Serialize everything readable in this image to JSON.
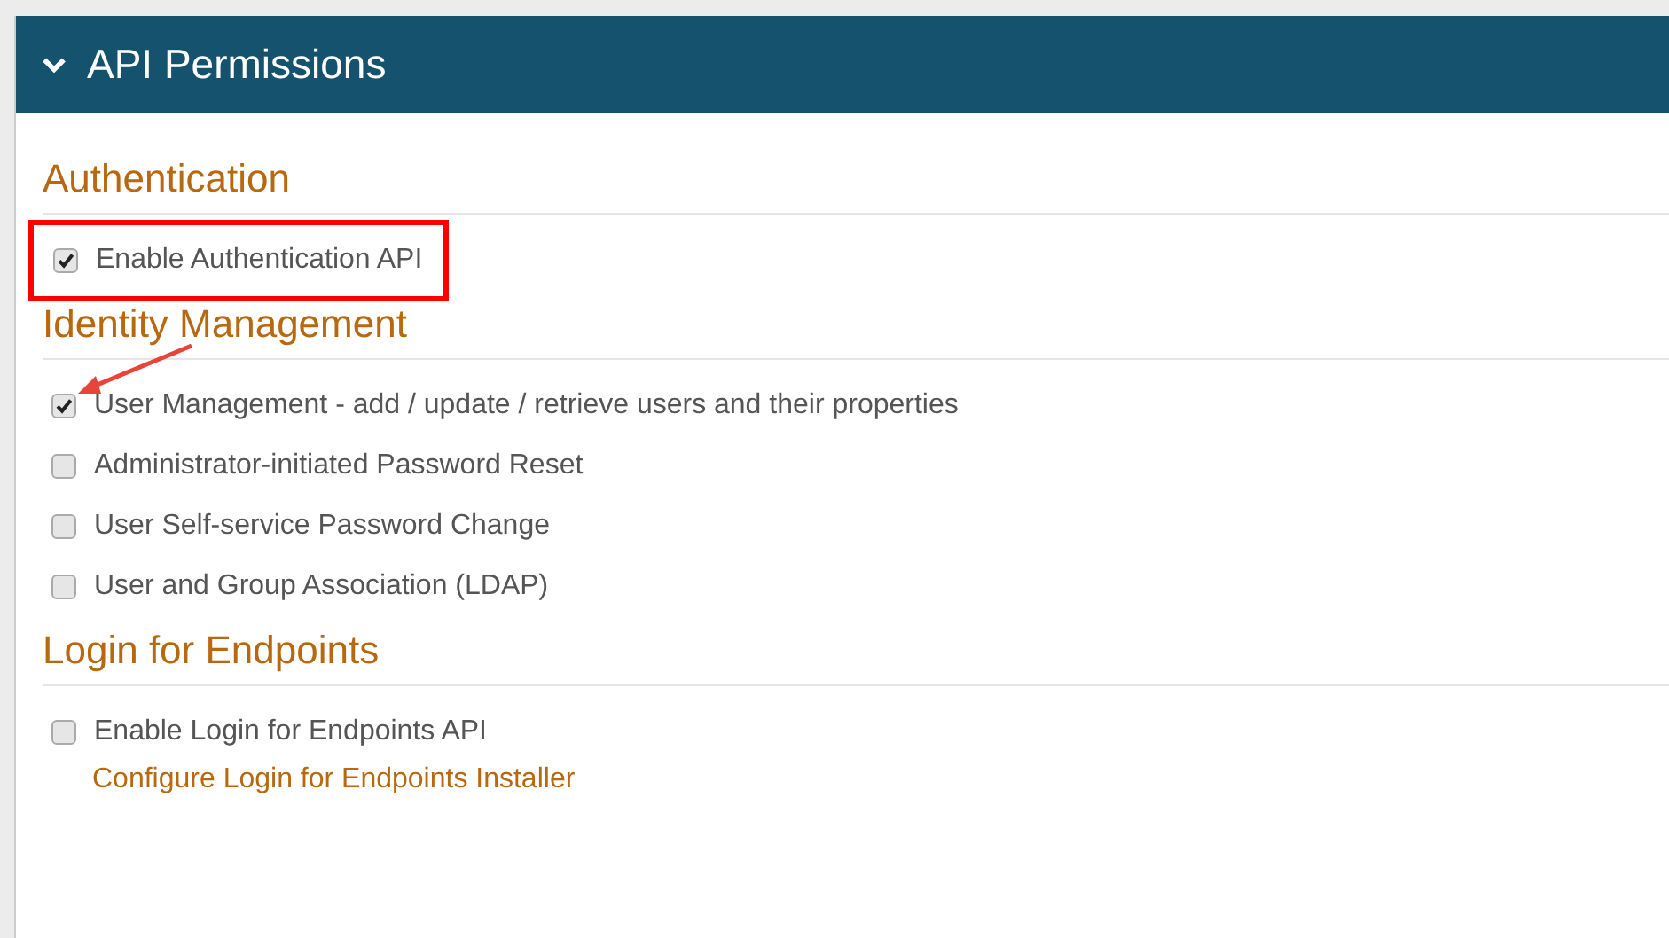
{
  "panel": {
    "title": "API Permissions",
    "expanded": true
  },
  "sections": [
    {
      "heading": "Authentication",
      "options": [
        {
          "label": "Enable Authentication API",
          "checked": true,
          "highlighted": true,
          "pointed": false
        }
      ]
    },
    {
      "heading": "Identity Management",
      "options": [
        {
          "label": "User Management - add / update / retrieve users and their properties",
          "checked": true,
          "highlighted": false,
          "pointed": true
        },
        {
          "label": "Administrator-initiated Password Reset",
          "checked": false,
          "highlighted": false,
          "pointed": false
        },
        {
          "label": "User Self-service Password Change",
          "checked": false,
          "highlighted": false,
          "pointed": false
        },
        {
          "label": "User and Group Association (LDAP)",
          "checked": false,
          "highlighted": false,
          "pointed": false
        }
      ]
    },
    {
      "heading": "Login for Endpoints",
      "options": [
        {
          "label": "Enable Login for Endpoints API",
          "checked": false,
          "highlighted": false,
          "pointed": false
        }
      ],
      "link": "Configure Login for Endpoints Installer"
    }
  ]
}
